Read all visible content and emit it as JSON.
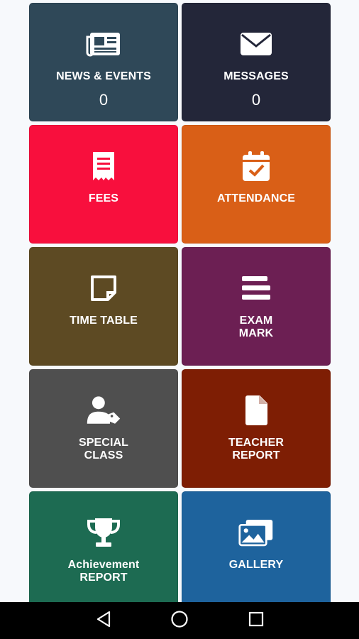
{
  "tiles": [
    {
      "name": "news-events-tile",
      "icon": "newspaper-icon",
      "label": "NEWS & EVENTS",
      "count": "0",
      "color": "#2f4858"
    },
    {
      "name": "messages-tile",
      "icon": "envelope-icon",
      "label": "MESSAGES",
      "count": "0",
      "color": "#232639"
    },
    {
      "name": "fees-tile",
      "icon": "receipt-icon",
      "label": "FEES",
      "color": "#f80f3d"
    },
    {
      "name": "attendance-tile",
      "icon": "calendar-check-icon",
      "label": "ATTENDANCE",
      "color": "#d95f17"
    },
    {
      "name": "time-table-tile",
      "icon": "sticky-note-icon",
      "label": "TIME TABLE",
      "color": "#5d4a23"
    },
    {
      "name": "exam-mark-tile",
      "icon": "list-bars-icon",
      "label": "EXAM\nMARK",
      "color": "#6c1f53"
    },
    {
      "name": "special-class-tile",
      "icon": "user-tag-icon",
      "label": "SPECIAL\nCLASS",
      "color": "#4f4f4f"
    },
    {
      "name": "teacher-report-tile",
      "icon": "document-icon",
      "label": "TEACHER\nREPORT",
      "color": "#7e1e04"
    },
    {
      "name": "achievement-report-tile",
      "icon": "trophy-icon",
      "label": "Achievement\nREPORT",
      "color": "#1d6b52"
    },
    {
      "name": "gallery-tile",
      "icon": "images-icon",
      "label": "GALLERY",
      "color": "#1e639d"
    }
  ],
  "navbar": {
    "back_icon": "back-triangle-icon",
    "home_icon": "home-circle-icon",
    "recents_icon": "recents-square-icon"
  }
}
